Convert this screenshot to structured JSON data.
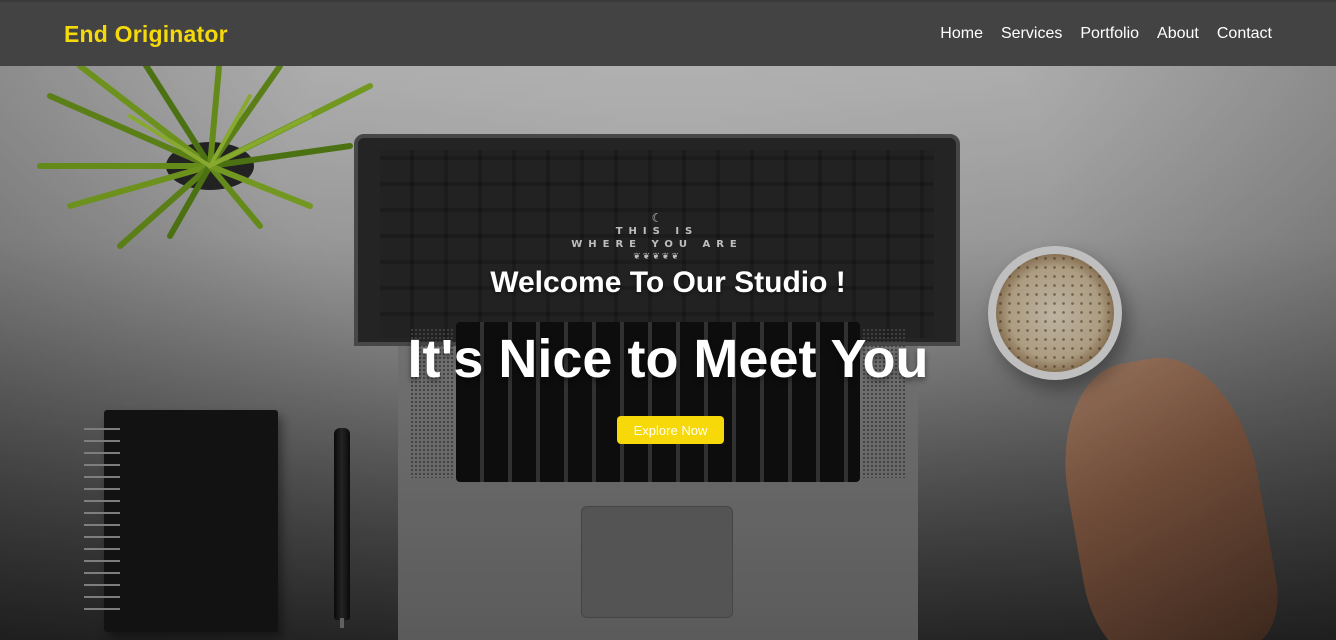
{
  "navbar": {
    "brand": "End Originator",
    "links": [
      "Home",
      "Services",
      "Portfolio",
      "About",
      "Contact"
    ]
  },
  "hero": {
    "welcome": "Welcome To Our Studio !",
    "headline": "It's Nice to Meet You",
    "cta_label": "Explore Now",
    "laptop_screen_text": [
      "THIS IS",
      "WHERE YOU ARE"
    ]
  },
  "colors": {
    "brand": "#f5d90a",
    "navbar_bg": "#434343",
    "cta_bg": "#f7d808",
    "text": "#ffffff"
  },
  "icons": [
    "moon-icon",
    "laurel-icon"
  ]
}
